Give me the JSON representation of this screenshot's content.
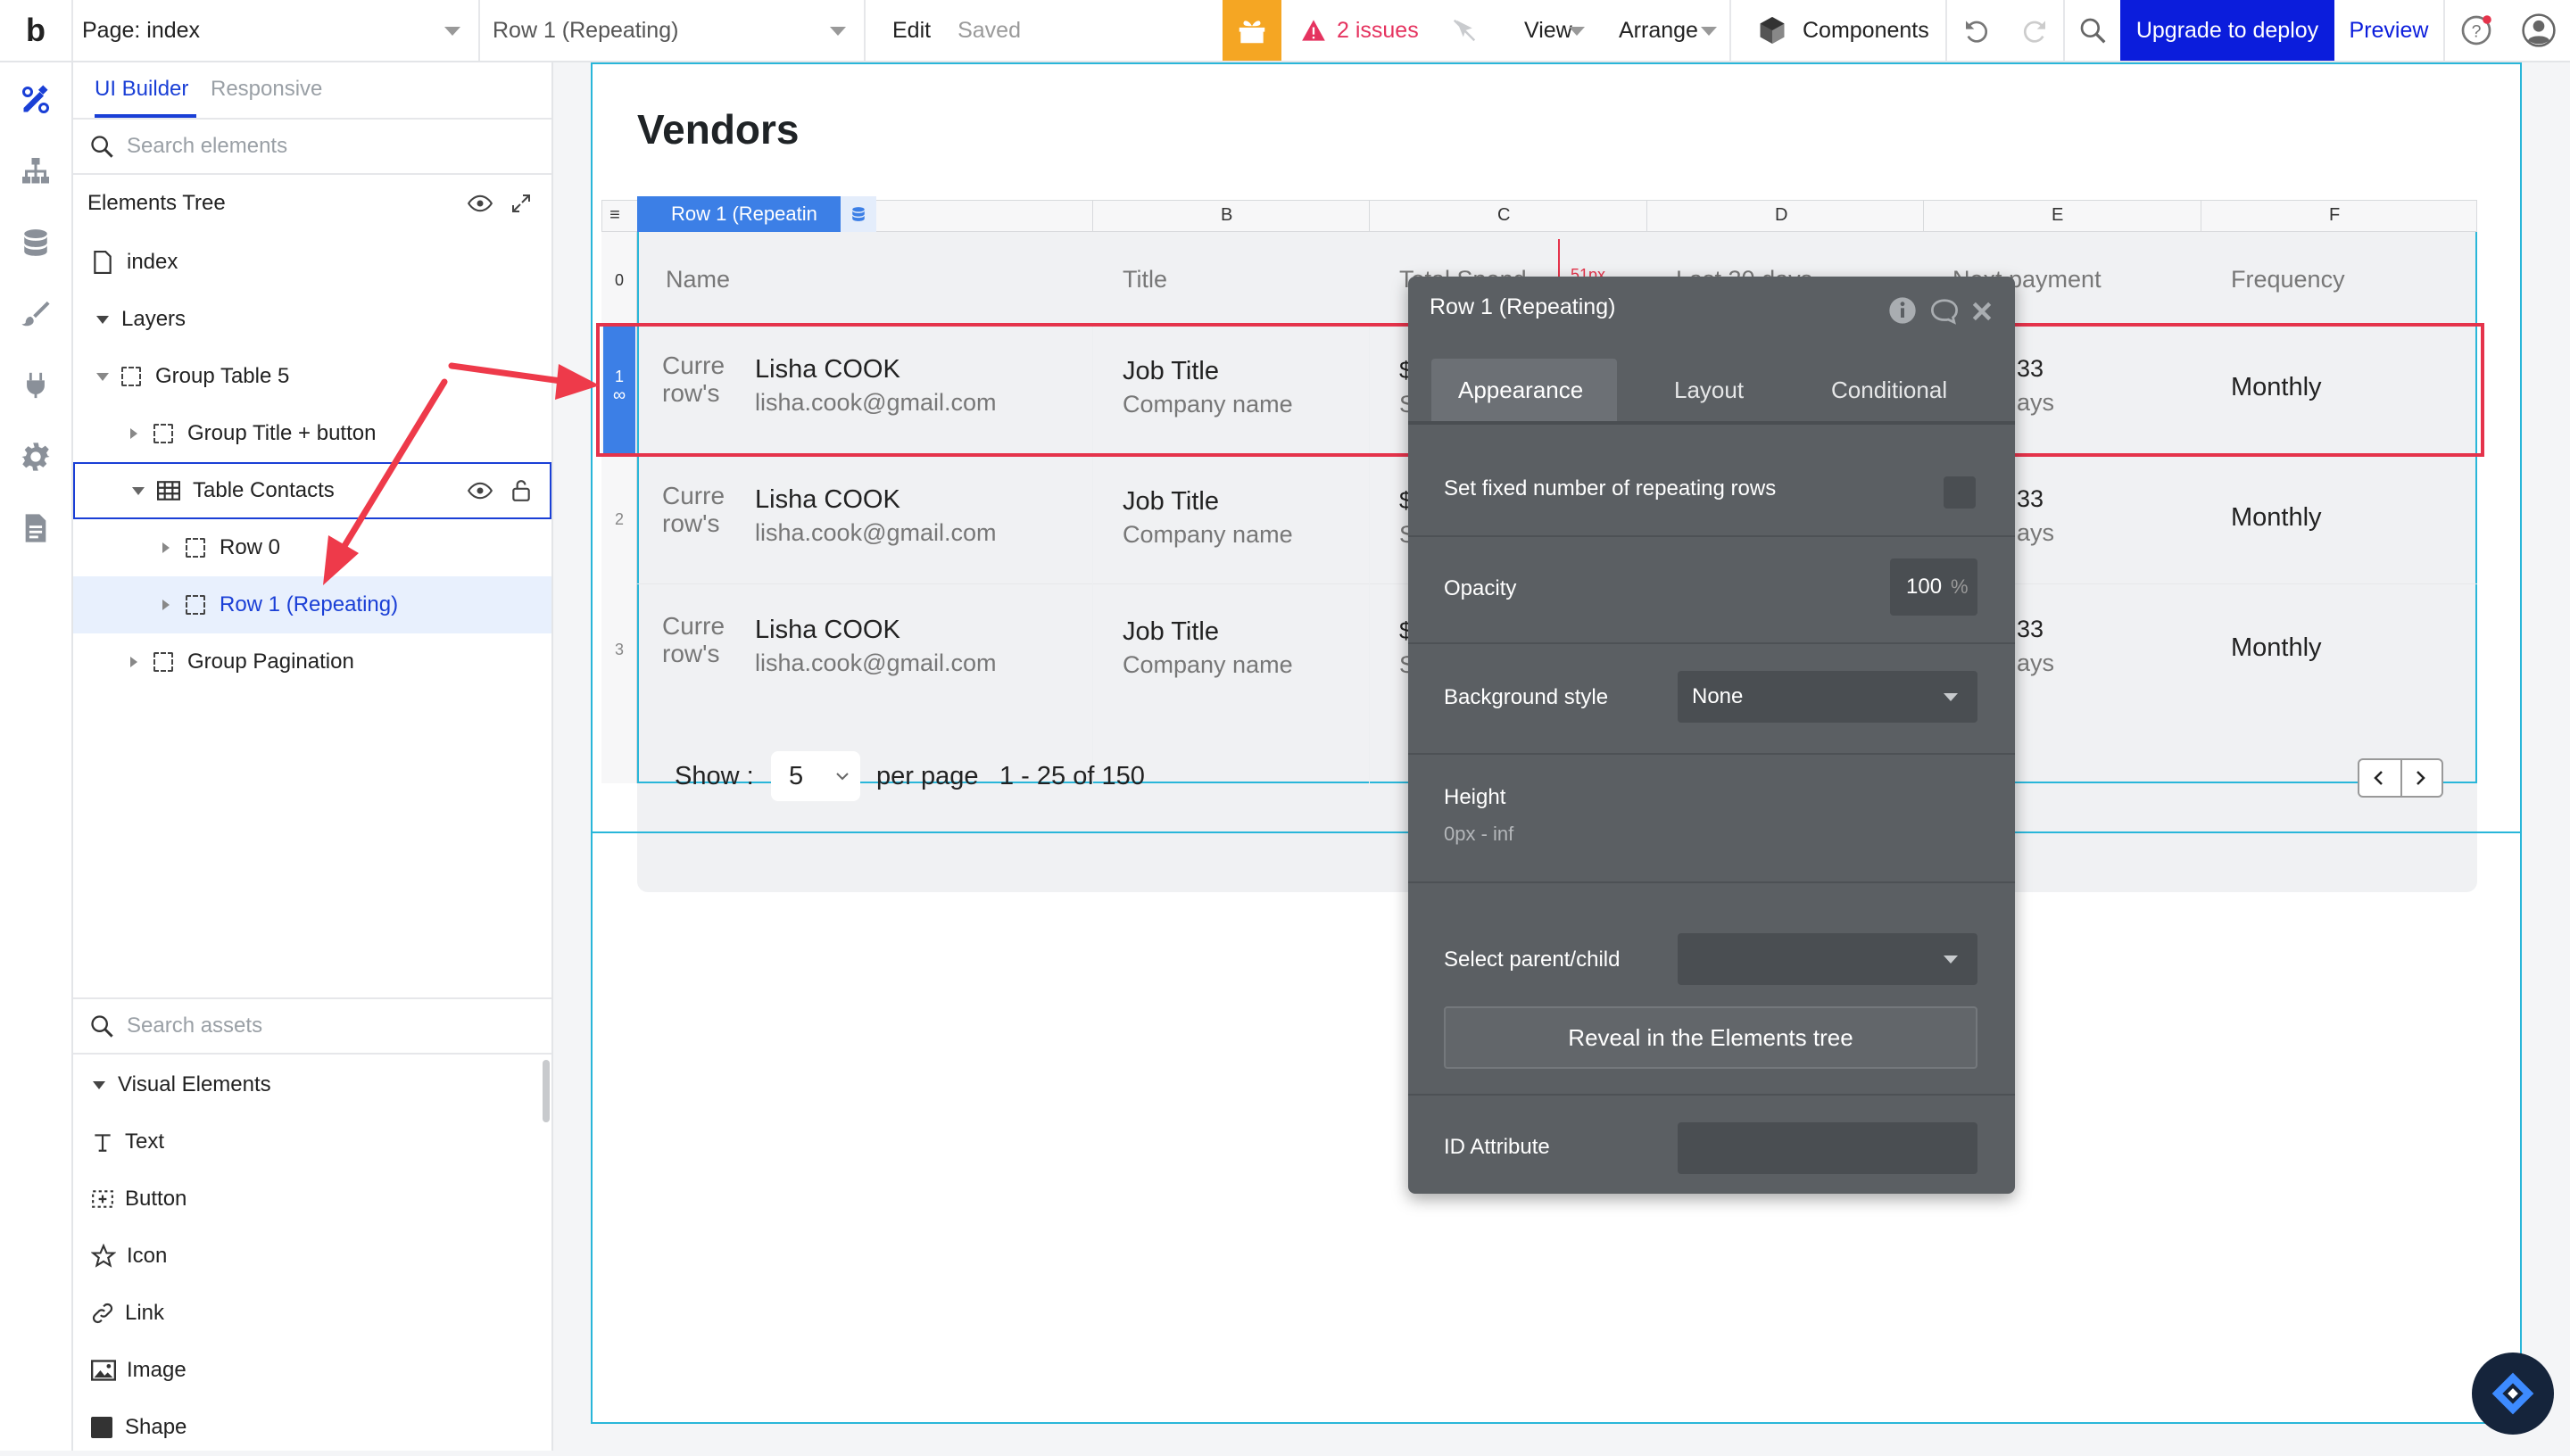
{
  "topbar": {
    "logo": "b",
    "page_label": "Page: index",
    "element_select": "Row 1 (Repeating)",
    "edit": "Edit",
    "saved": "Saved",
    "issues": "2 issues",
    "view": "View",
    "arrange": "Arrange",
    "components": "Components",
    "upgrade": "Upgrade to deploy",
    "preview": "Preview",
    "colors": {
      "gift_bg": "#f5a623",
      "issues": "#e5335f",
      "upgrade_bg": "#0b1ddc"
    }
  },
  "left_panel": {
    "tabs": [
      "UI Builder",
      "Responsive"
    ],
    "search_elements_placeholder": "Search elements",
    "elements_tree_title": "Elements Tree",
    "tree": [
      {
        "label": "index"
      },
      {
        "label": "Layers"
      },
      {
        "label": "Group Table 5"
      },
      {
        "label": "Group Title + button"
      },
      {
        "label": "Table Contacts"
      },
      {
        "label": "Row 0"
      },
      {
        "label": "Row 1 (Repeating)"
      },
      {
        "label": "Group Pagination"
      }
    ],
    "search_assets_placeholder": "Search assets",
    "visual_elements_title": "Visual Elements",
    "visual_elements": [
      "Text",
      "Button",
      "Icon",
      "Link",
      "Image",
      "Shape"
    ]
  },
  "canvas": {
    "page_title": "Vendors",
    "selection_tag": "Row 1 (Repeatin",
    "col_letters": [
      "B",
      "C",
      "D",
      "E",
      "F"
    ],
    "row_numbers": [
      "0",
      "1",
      "2",
      "3"
    ],
    "row_marker": "51px",
    "headers": [
      "Name",
      "Title",
      "Total Spend",
      "Last 30 days",
      "Next payment",
      "Frequency"
    ],
    "rows": [
      {
        "avatar": "Curre row's",
        "name": "Lisha COOK",
        "email": "lisha.cook@gmail.com",
        "title": "Job Title",
        "company": "Company name",
        "spend": "$",
        "spend_sub": "S",
        "next": "33",
        "next_sub": "ays",
        "frequency": "Monthly"
      },
      {
        "avatar": "Curre row's",
        "name": "Lisha COOK",
        "email": "lisha.cook@gmail.com",
        "title": "Job Title",
        "company": "Company name",
        "spend": "$",
        "spend_sub": "S",
        "next": "33",
        "next_sub": "ays",
        "frequency": "Monthly"
      },
      {
        "avatar": "Curre row's",
        "name": "Lisha COOK",
        "email": "lisha.cook@gmail.com",
        "title": "Job Title",
        "company": "Company name",
        "spend": "$",
        "spend_sub": "S",
        "next": "33",
        "next_sub": "ays",
        "frequency": "Monthly"
      }
    ],
    "pagination": {
      "show_label": "Show :",
      "per_page_value": "5",
      "per_page_label": "per page",
      "range": "1 - 25 of 150"
    },
    "colors": {
      "selection": "#e5334b",
      "blue": "#3c7fe6",
      "page_border": "#29b6d9"
    }
  },
  "popup": {
    "title": "Row 1 (Repeating)",
    "tabs": [
      "Appearance",
      "Layout",
      "Conditional"
    ],
    "fixed_rows_label": "Set fixed number of repeating rows",
    "opacity_label": "Opacity",
    "opacity_value": "100",
    "opacity_unit": "%",
    "background_label": "Background style",
    "background_value": "None",
    "height_label": "Height",
    "height_value": "0px - inf",
    "parent_child_label": "Select parent/child",
    "reveal_button": "Reveal in the Elements tree",
    "id_attribute_label": "ID Attribute"
  }
}
